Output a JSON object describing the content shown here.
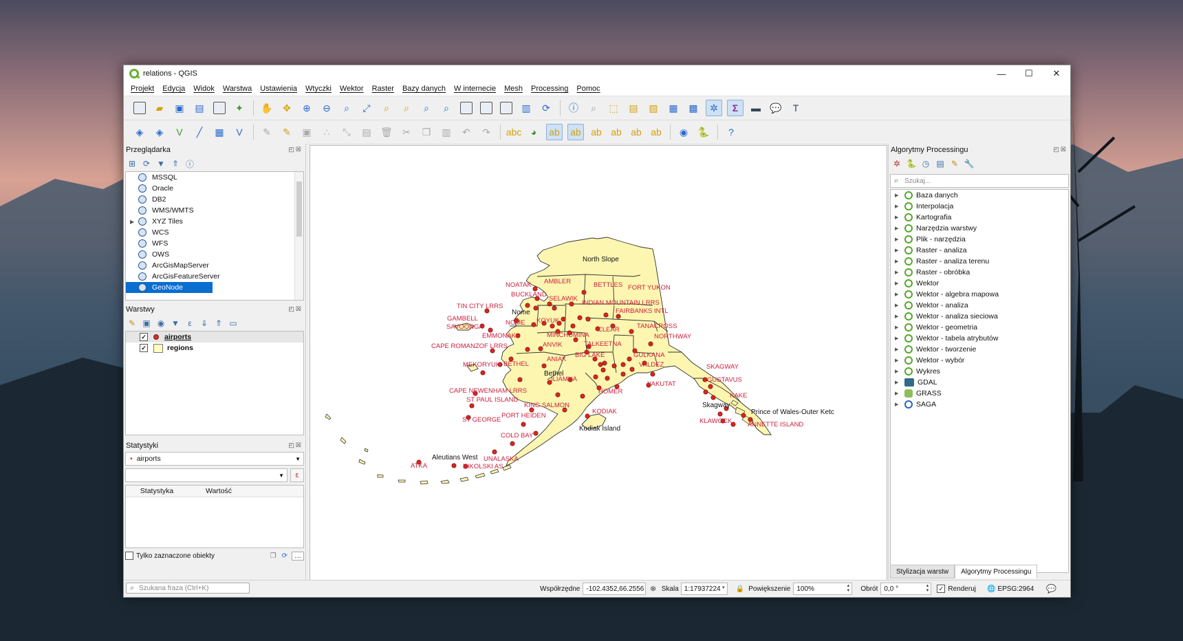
{
  "window": {
    "title": "relations - QGIS"
  },
  "menu": [
    "Projekt",
    "Edycja",
    "Widok",
    "Warstwa",
    "Ustawienia",
    "Wtyczki",
    "Wektor",
    "Raster",
    "Bazy danych",
    "W internecie",
    "Mesh",
    "Processing",
    "Pomoc"
  ],
  "browser": {
    "title": "Przeglądarka",
    "items": [
      "MSSQL",
      "Oracle",
      "DB2",
      "WMS/WMTS",
      "XYZ Tiles",
      "WCS",
      "WFS",
      "OWS",
      "ArcGisMapServer",
      "ArcGisFeatureServer",
      "GeoNode"
    ],
    "selected": "GeoNode"
  },
  "layers": {
    "title": "Warstwy",
    "items": [
      {
        "name": "airports",
        "checked": true
      },
      {
        "name": "regions",
        "checked": true
      }
    ]
  },
  "stats": {
    "title": "Statystyki",
    "layer": "airports",
    "col1": "Statystyka",
    "col2": "Wartość",
    "only_selected": "Tylko zaznaczone obiekty",
    "search_placeholder": "Szukana fraza (Ctrl+K)"
  },
  "processing": {
    "title": "Algorytmy Processingu",
    "search_placeholder": "Szukaj...",
    "items": [
      "Baza danych",
      "Interpolacja",
      "Kartografia",
      "Narzędzia warstwy",
      "Plik - narzędzia",
      "Raster - analiza",
      "Raster - analiza terenu",
      "Raster - obróbka",
      "Wektor",
      "Wektor - algebra mapowa",
      "Wektor - analiza",
      "Wektor - analiza sieciowa",
      "Wektor - geometria",
      "Wektor - tabela atrybutów",
      "Wektor - tworzenie",
      "Wektor - wybór",
      "Wykres",
      "GDAL",
      "GRASS",
      "SAGA"
    ],
    "tab1": "Stylizacja warstw",
    "tab2": "Algorytmy Processingu"
  },
  "map": {
    "region_labels": [
      "North Slope",
      "Nome",
      "Bethel",
      "Kodiak Island",
      "Aleutians West",
      "Prince of Wales-Outer Ketc",
      "Skagway"
    ],
    "airport_labels": [
      "NOATAK",
      "AMBLER",
      "BETTLES",
      "FORT YUKON",
      "BUCKLAND",
      "SELAWIK",
      "TIN CITY LRRS",
      "INDIAN MOUNTAIN LRRS",
      "FAIRBANKS INTL",
      "GAMBELL",
      "NOME",
      "KOYUK",
      "SAVOONGA",
      "TANACROSS",
      "CLEAR",
      "EMMONAK",
      "MINCHUMINA",
      "NORTHWAY",
      "CAPE ROMANZOF LRRS",
      "ANVIK",
      "TALKEETNA",
      "GULKANA",
      "BIG LAKE",
      "MEKORYUK",
      "BETHEL",
      "ANIAK",
      "VALDEZ",
      "SKAGWAY",
      "ILIAMNA",
      "GUSTAVUS",
      "YAKUTAT",
      "CAPE NEWENHAM LRRS",
      "HOMER",
      "ST PAUL ISLAND",
      "KING SALMON",
      "KAKE",
      "KODIAK",
      "PORT HEIDEN",
      "ST GEORGE",
      "KLAWOCK",
      "ANNETTE ISLAND",
      "COLD BAY",
      "UNALASKA",
      "ATKA",
      "NIKOLSKI AS"
    ],
    "colors": {
      "fill": "#fcf6b0",
      "border": "#333333",
      "airport": "#d9261c",
      "label": "#cc1e3c"
    }
  },
  "status": {
    "coord_label": "Współrzędne",
    "coord_value": "-102.4352,66.2556",
    "scale_label": "Skala",
    "scale_value": "1:17937224",
    "zoom_label": "Powiększenie",
    "zoom_value": "100%",
    "rotation_label": "Obrót",
    "rotation_value": "0,0 °",
    "render_label": "Renderuj",
    "epsg": "EPSG:2964"
  }
}
